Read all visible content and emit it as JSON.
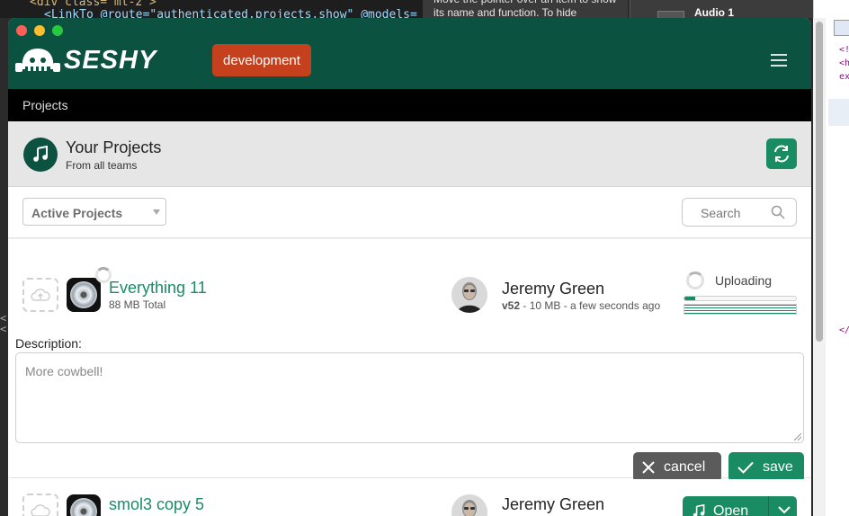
{
  "background": {
    "editor_line1": "<div class=\"ml-2\">",
    "editor_line2": "<LinkTo @route=\"authenticated.projects.show\" @models=",
    "tooltip_text": "Move the pointer over an item to show its name and function. To hide",
    "daw_track": "Audio 1",
    "devtools_lines": [
      "<!",
      "<h",
      "ex",
      "</"
    ]
  },
  "header": {
    "logo_text": "SESHY",
    "environment_badge": "development"
  },
  "breadcrumb": "Projects",
  "page": {
    "title": "Your Projects",
    "subtitle": "From all teams"
  },
  "filters": {
    "select_value": "Active Projects",
    "search_placeholder": "Search"
  },
  "projects": [
    {
      "name": "Everything 11",
      "size": "88 MB Total",
      "user": "Jeremy Green",
      "version": "v52",
      "version_detail": "- 10 MB - a few seconds ago",
      "status": "Uploading",
      "upload_progress": 0.1,
      "description_label": "Description:",
      "description_placeholder": "More cowbell!",
      "cancel_label": "cancel",
      "save_label": "save"
    },
    {
      "name": "smol3 copy 5",
      "user": "Jeremy Green",
      "open_label": "Open"
    }
  ],
  "colors": {
    "brand_dark": "#0c5240",
    "accent_green": "#1a8c63",
    "badge_red": "#c5401c"
  }
}
